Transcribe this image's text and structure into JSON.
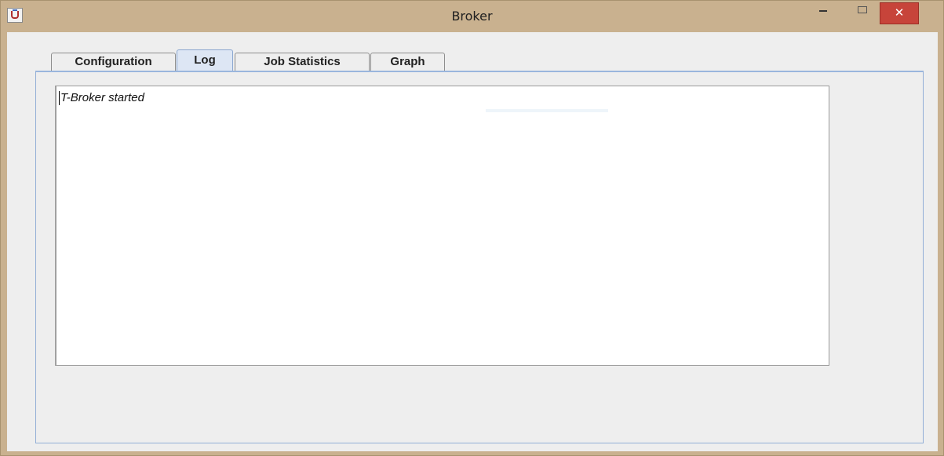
{
  "window": {
    "title": "Broker",
    "close_glyph": "✕"
  },
  "tabs": [
    {
      "label": "Configuration",
      "active": false
    },
    {
      "label": "Log",
      "active": true
    },
    {
      "label": "Job Statistics",
      "active": false
    },
    {
      "label": "Graph",
      "active": false
    }
  ],
  "log": {
    "lines": [
      "T-Broker started"
    ]
  },
  "icons": {
    "app": "java-cup-icon",
    "minimize": "minimize-icon",
    "maximize": "maximize-icon",
    "close": "close-icon",
    "cursor": "text-cursor-icon"
  },
  "colors": {
    "titlebar": "#c9b18f",
    "close_button": "#c7443a",
    "active_tab": "#dde6f4",
    "panel_border": "#92aed6"
  }
}
